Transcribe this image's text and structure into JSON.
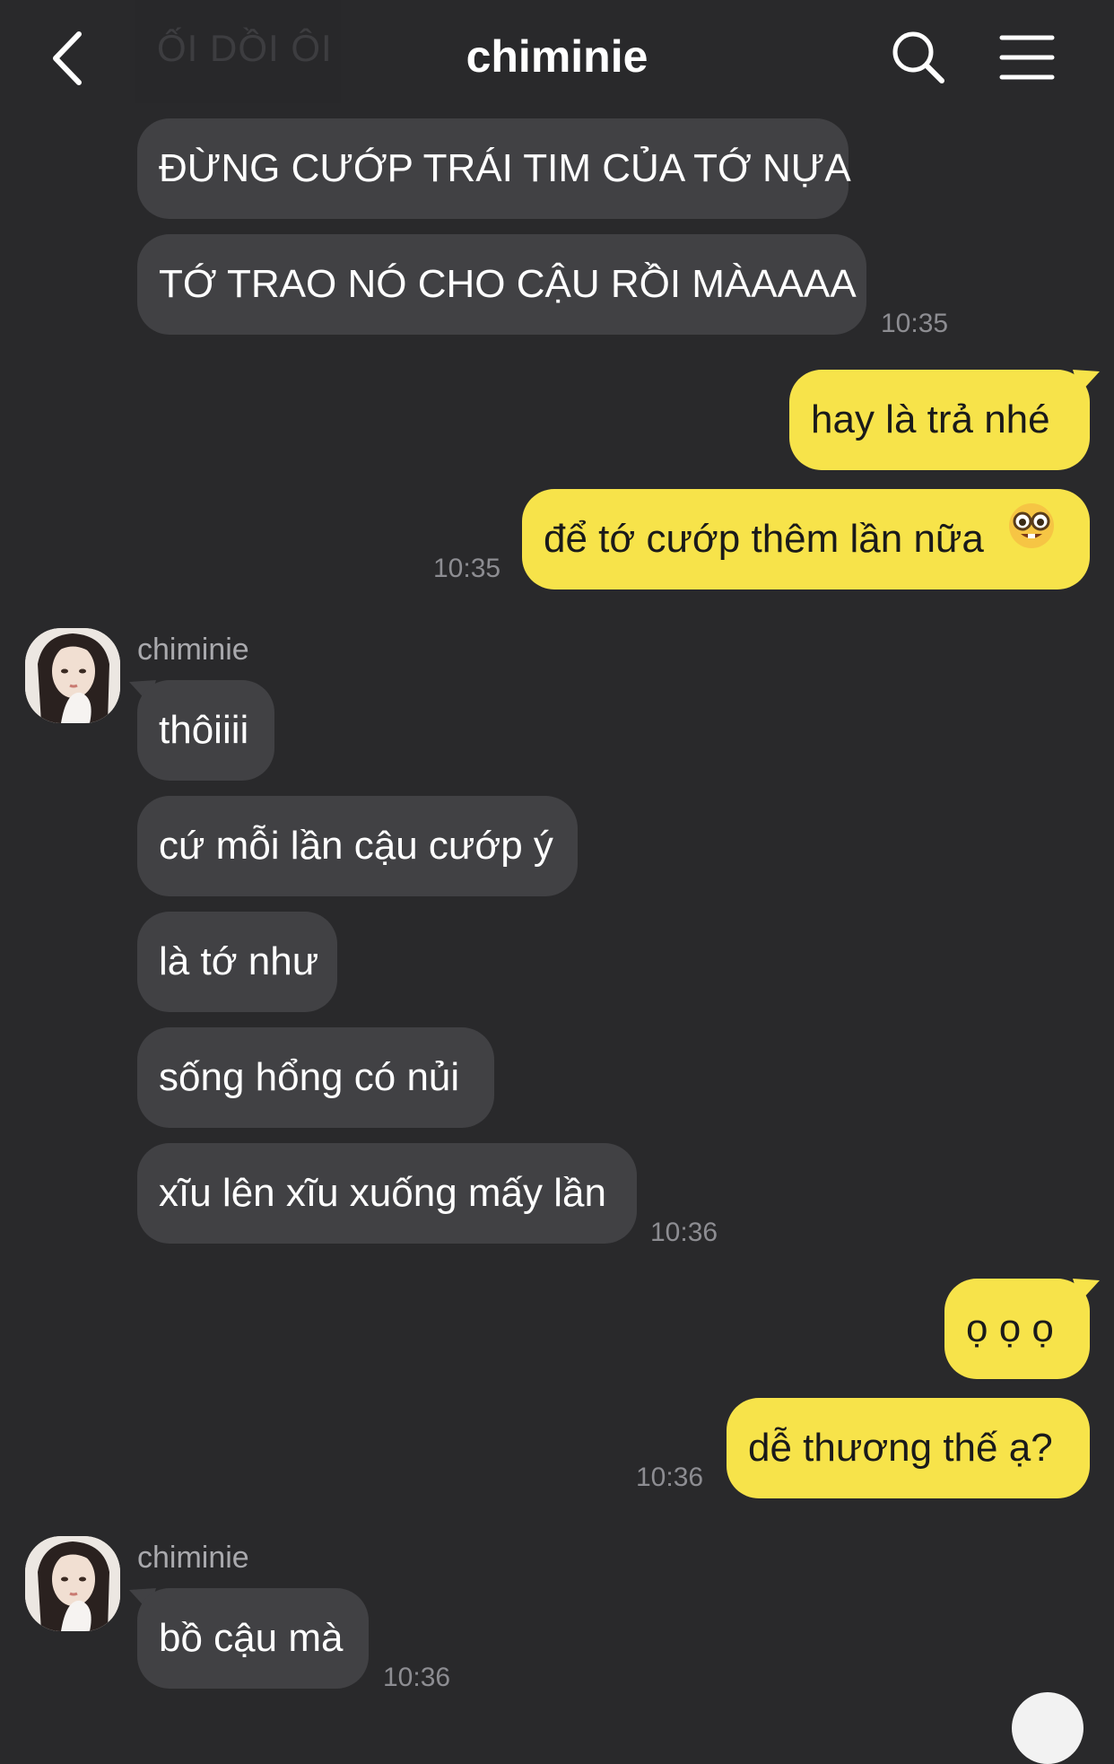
{
  "header": {
    "title": "chiminie",
    "ghost_text": "ỐI DỒI ÔI"
  },
  "messages": [
    {
      "text": "ĐỪNG CƯỚP TRÁI TIM CỦA TỚ NỰA"
    },
    {
      "text": "TỚ TRAO NÓ CHO CẬU RỒI MÀAAAA",
      "time": "10:35"
    },
    {
      "text": "hay là trả nhé"
    },
    {
      "text": "để tớ cướp thêm lần nữa",
      "emoji": "nerd-face",
      "time": "10:35"
    },
    {
      "sender": "chiminie",
      "text": "thôiiii"
    },
    {
      "text": "cứ mỗi lần cậu cướp ý"
    },
    {
      "text": "là tớ như"
    },
    {
      "text": "sống hổng có nủi"
    },
    {
      "text": "xĩu lên xĩu xuống mấy lần",
      "time": "10:36"
    },
    {
      "text": "ọ ọ ọ"
    },
    {
      "text": "dễ thương thế ạ?",
      "time": "10:36"
    },
    {
      "sender": "chiminie",
      "text": "bồ cậu mà",
      "time": "10:36"
    }
  ],
  "colors": {
    "background": "#29292b",
    "incoming_bubble": "#414144",
    "outgoing_bubble": "#f7e34a"
  }
}
